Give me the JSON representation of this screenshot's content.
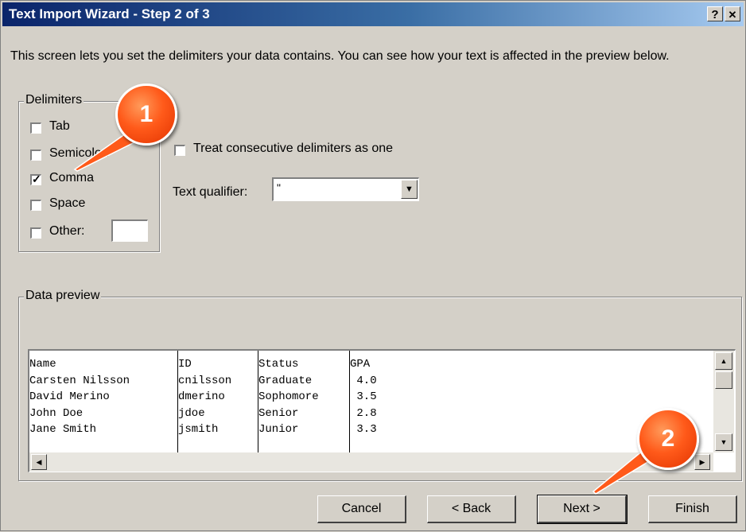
{
  "window": {
    "title": "Text Import Wizard - Step 2 of 3",
    "help_label": "?",
    "close_label": "✕"
  },
  "intro_text": "This screen lets you set the delimiters your data contains.  You can see how your text is affected in the preview below.",
  "delimiters": {
    "group_label": "Delimiters",
    "tab": {
      "label": "Tab",
      "checked": false
    },
    "semicolon": {
      "label": "Semicolon",
      "checked": false
    },
    "comma": {
      "label": "Comma",
      "checked": true
    },
    "space": {
      "label": "Space",
      "checked": false
    },
    "other": {
      "label": "Other:",
      "checked": false,
      "value": ""
    }
  },
  "options": {
    "consecutive_label": "Treat consecutive delimiters as one",
    "consecutive_checked": false,
    "qualifier_label": "Text qualifier:",
    "qualifier_value": "\""
  },
  "preview": {
    "group_label": "Data preview",
    "columns": [
      {
        "lines": "Name\nCarsten Nilsson\nDavid Merino\nJohn Doe\nJane Smith"
      },
      {
        "lines": "ID\ncnilsson\ndmerino\njdoe\njsmith"
      },
      {
        "lines": "Status\nGraduate\nSophomore\nSenior\nJunior"
      },
      {
        "lines": "GPA\n 4.0\n 3.5\n 2.8\n 3.3"
      }
    ]
  },
  "buttons": {
    "cancel": "Cancel",
    "back": "< Back",
    "next": "Next >",
    "finish": "Finish"
  },
  "callouts": {
    "one": "1",
    "two": "2",
    "color": "#ff5a1a"
  }
}
